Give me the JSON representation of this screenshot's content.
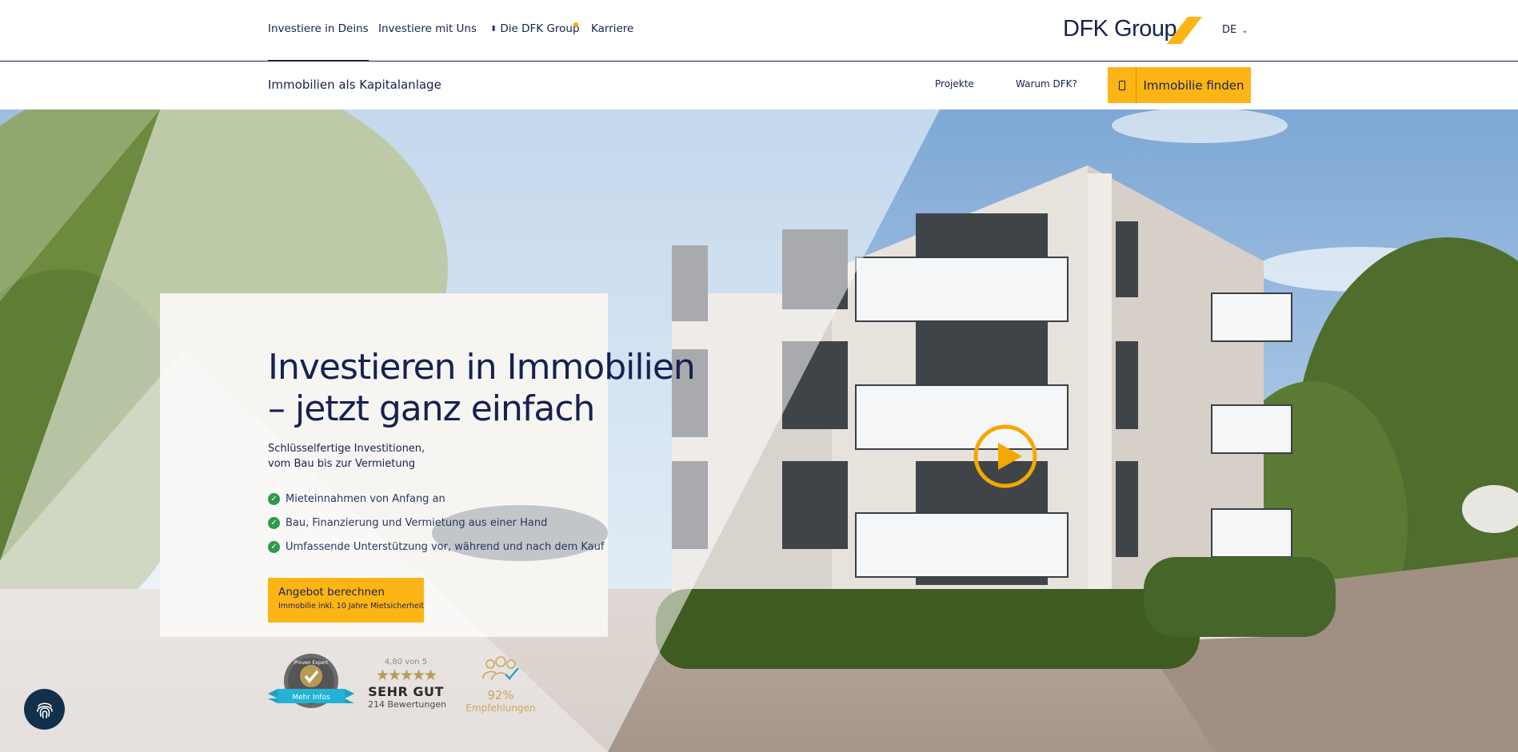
{
  "topnav": {
    "items": [
      {
        "label": "Investiere in Deins",
        "active": true
      },
      {
        "label": "Investiere mit Uns",
        "active": false
      },
      {
        "label": "Die DFK Group",
        "active": false
      },
      {
        "label": "Karriere",
        "active": false
      }
    ],
    "logo_text": "DFK Group",
    "language": "DE"
  },
  "subnav": {
    "title": "Immobilien als Kapitalanlage",
    "links": [
      "Projekte",
      "Warum DFK?"
    ],
    "find_button": "Immobilie finden"
  },
  "hero": {
    "headline_line1": "Investieren in Immobilien",
    "headline_line2": "– jetzt ganz einfach",
    "subline_line1": "Schlüsselfertige Investitionen,",
    "subline_line2": "vom Bau bis zur Vermietung",
    "bullets": [
      "Mieteinnahmen von Anfang an",
      "Bau, Finanzierung und Vermietung aus einer Hand",
      "Umfassende Unterstützung vor, während und nach dem Kauf"
    ],
    "cta_title": "Angebot berechnen",
    "cta_subtitle": "Immobilie inkl. 10 Jahre Mietsicherheit"
  },
  "badges": {
    "proven_expert_ribbon": "Mehr Infos",
    "proven_expert_logo_text": "Proven Expert",
    "rating_score": "4,80 von 5",
    "stars": "★★★★★",
    "rating_label": "SEHR GUT",
    "rating_count": "214 Bewertungen",
    "recommend_pct": "92%",
    "recommend_label": "Empfehlungen"
  },
  "colors": {
    "navy": "#16214f",
    "accent": "#fdb515",
    "check_green": "#2d9a4a",
    "gold": "#c9a85e"
  },
  "icons": [
    "updown-icon",
    "chevron-down-icon",
    "phone-icon",
    "check-icon",
    "play-icon",
    "fingerprint-icon"
  ]
}
